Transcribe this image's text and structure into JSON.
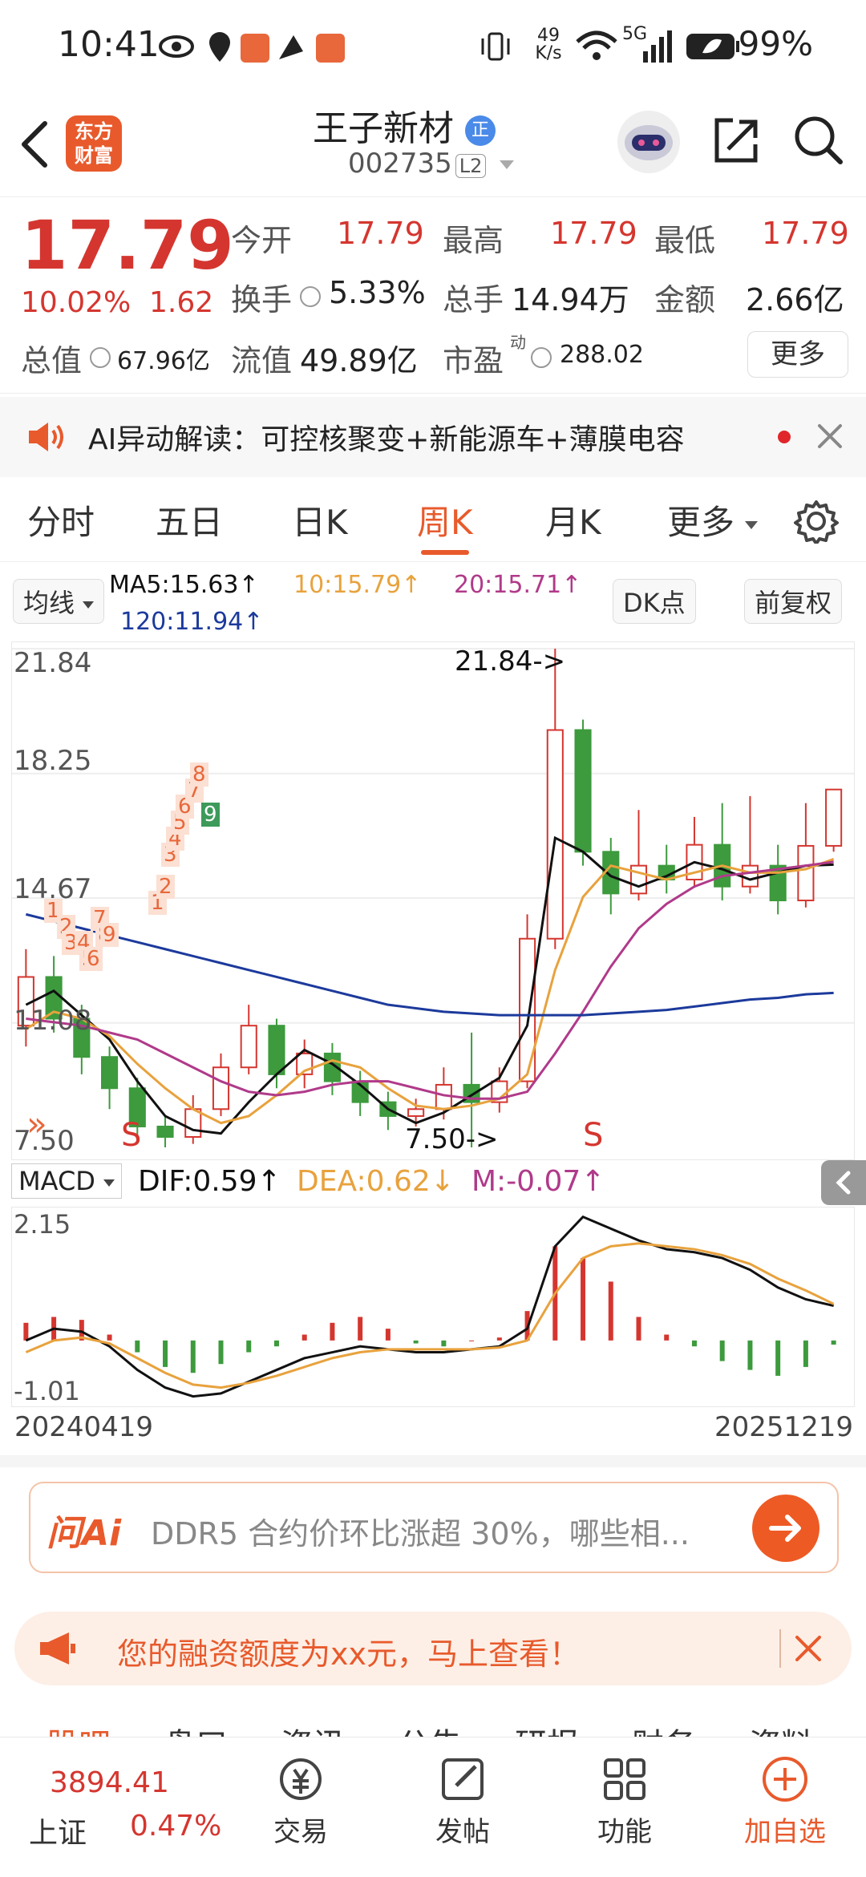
{
  "status": {
    "time": "10:41",
    "net_speed_top": "49",
    "net_speed_bottom": "K/s",
    "network": "5G",
    "battery": "99%"
  },
  "header": {
    "brand_line1": "东方",
    "brand_line2": "财富",
    "stock_name": "王子新材",
    "badge": "正",
    "code": "002735",
    "level_tag": "L2"
  },
  "quote": {
    "price": "17.79",
    "change_pct": "10.02%",
    "change": "1.62",
    "open_label": "今开",
    "open": "17.79",
    "high_label": "最高",
    "high": "17.79",
    "low_label": "最低",
    "low": "17.79",
    "turnover_label": "换手",
    "turnover": "5.33%",
    "volume_label": "总手",
    "volume": "14.94万",
    "amount_label": "金额",
    "amount": "2.66亿",
    "mcap_label": "总值",
    "mcap": "67.96亿",
    "float_label": "流值",
    "float": "49.89亿",
    "pe_label": "市盈",
    "pe_sup": "动",
    "pe": "288.02",
    "more_button": "更多"
  },
  "ai_banner": {
    "text": "AI异动解读：可控核聚变+新能源车+薄膜电容"
  },
  "tabs": [
    {
      "label": "分时"
    },
    {
      "label": "五日"
    },
    {
      "label": "日K"
    },
    {
      "label": "周K"
    },
    {
      "label": "月K"
    },
    {
      "label": "更多"
    }
  ],
  "active_tab": "周K",
  "ma_bar": {
    "selector": "均线",
    "ma5": "MA5:15.63↑",
    "ma10": "10:15.79↑",
    "ma20": "20:15.71↑",
    "ma120": "120:11.94↑",
    "dk_button": "DK点",
    "fq_button": "前复权"
  },
  "chart_data": {
    "type": "candlestick",
    "period": "weekly",
    "y_labels": [
      "21.84",
      "18.25",
      "14.67",
      "11.08",
      "7.50"
    ],
    "max_marker": "21.84->",
    "min_marker": "7.50->",
    "signal_marks": [
      "S",
      "S"
    ],
    "td_counts": [
      "1",
      "2",
      "3",
      "4",
      "5",
      "6",
      "7",
      "8",
      "9"
    ],
    "ylim": [
      7.5,
      21.84
    ],
    "ma_lines": [
      {
        "name": "MA5",
        "color": "#111111",
        "values": [
          11.6,
          12.0,
          11.3,
          10.6,
          9.4,
          8.4,
          8.0,
          7.9,
          8.8,
          9.6,
          10.3,
          9.9,
          9.3,
          8.6,
          8.2,
          8.5,
          9.0,
          9.5,
          11.0,
          16.4,
          16.0,
          15.3,
          15.0,
          15.3,
          15.7,
          15.5,
          15.2,
          15.4,
          15.6,
          15.63
        ]
      },
      {
        "name": "MA10",
        "color": "#e8a23d",
        "values": [
          10.9,
          11.4,
          11.2,
          10.7,
          9.9,
          9.2,
          8.6,
          8.2,
          8.4,
          9.0,
          9.7,
          10.0,
          9.8,
          9.2,
          8.7,
          8.6,
          8.7,
          8.9,
          9.6,
          12.6,
          14.7,
          15.6,
          15.4,
          15.2,
          15.4,
          15.6,
          15.4,
          15.4,
          15.5,
          15.79
        ]
      },
      {
        "name": "MA20",
        "color": "#b03a8a",
        "values": [
          11.2,
          11.1,
          11.0,
          10.8,
          10.6,
          10.2,
          9.8,
          9.4,
          9.1,
          9.0,
          9.1,
          9.3,
          9.4,
          9.4,
          9.2,
          9.0,
          8.9,
          8.9,
          9.1,
          10.2,
          11.4,
          12.7,
          13.8,
          14.5,
          15.0,
          15.3,
          15.4,
          15.5,
          15.6,
          15.71
        ]
      },
      {
        "name": "MA120",
        "color": "#1c3a9c",
        "values": [
          14.2,
          14.0,
          13.8,
          13.6,
          13.4,
          13.2,
          13.0,
          12.8,
          12.6,
          12.4,
          12.2,
          12.0,
          11.8,
          11.6,
          11.5,
          11.4,
          11.35,
          11.3,
          11.3,
          11.3,
          11.3,
          11.35,
          11.4,
          11.45,
          11.55,
          11.65,
          11.75,
          11.8,
          11.9,
          11.94
        ]
      }
    ],
    "candles": [
      {
        "o": 11.0,
        "c": 12.4,
        "h": 13.2,
        "l": 10.4
      },
      {
        "o": 12.4,
        "c": 11.2,
        "h": 13.0,
        "l": 10.8
      },
      {
        "o": 11.2,
        "c": 10.1,
        "h": 11.6,
        "l": 9.6
      },
      {
        "o": 10.1,
        "c": 9.2,
        "h": 10.4,
        "l": 8.6
      },
      {
        "o": 9.2,
        "c": 8.1,
        "h": 9.5,
        "l": 7.8
      },
      {
        "o": 8.1,
        "c": 7.8,
        "h": 8.4,
        "l": 7.5
      },
      {
        "o": 7.8,
        "c": 8.6,
        "h": 9.0,
        "l": 7.6
      },
      {
        "o": 8.6,
        "c": 9.8,
        "h": 10.2,
        "l": 8.4
      },
      {
        "o": 9.8,
        "c": 11.0,
        "h": 11.6,
        "l": 9.6
      },
      {
        "o": 11.0,
        "c": 9.6,
        "h": 11.2,
        "l": 9.2
      },
      {
        "o": 9.6,
        "c": 10.2,
        "h": 10.6,
        "l": 9.2
      },
      {
        "o": 10.2,
        "c": 9.4,
        "h": 10.5,
        "l": 9.0
      },
      {
        "o": 9.4,
        "c": 8.8,
        "h": 9.7,
        "l": 8.4
      },
      {
        "o": 8.8,
        "c": 8.4,
        "h": 9.1,
        "l": 8.0
      },
      {
        "o": 8.4,
        "c": 8.6,
        "h": 8.9,
        "l": 8.1
      },
      {
        "o": 8.6,
        "c": 9.3,
        "h": 9.8,
        "l": 8.3
      },
      {
        "o": 9.3,
        "c": 8.8,
        "h": 10.8,
        "l": 7.5
      },
      {
        "o": 8.8,
        "c": 9.4,
        "h": 9.8,
        "l": 8.5
      },
      {
        "o": 9.4,
        "c": 13.5,
        "h": 14.2,
        "l": 9.2
      },
      {
        "o": 13.5,
        "c": 19.5,
        "h": 21.84,
        "l": 13.2
      },
      {
        "o": 19.5,
        "c": 16.0,
        "h": 19.8,
        "l": 15.6
      },
      {
        "o": 16.0,
        "c": 14.8,
        "h": 16.4,
        "l": 14.2
      },
      {
        "o": 14.8,
        "c": 15.6,
        "h": 17.2,
        "l": 14.6
      },
      {
        "o": 15.6,
        "c": 15.2,
        "h": 16.2,
        "l": 14.8
      },
      {
        "o": 15.2,
        "c": 16.2,
        "h": 17.0,
        "l": 15.0
      },
      {
        "o": 16.2,
        "c": 15.0,
        "h": 17.4,
        "l": 14.6
      },
      {
        "o": 15.0,
        "c": 15.6,
        "h": 17.6,
        "l": 14.8
      },
      {
        "o": 15.6,
        "c": 14.6,
        "h": 16.2,
        "l": 14.2
      },
      {
        "o": 14.6,
        "c": 16.17,
        "h": 17.4,
        "l": 14.4
      },
      {
        "o": 16.17,
        "c": 17.79,
        "h": 17.79,
        "l": 16.0
      }
    ]
  },
  "macd": {
    "selector": "MACD",
    "dif": "DIF:0.59↑",
    "dea": "DEA:0.62↓",
    "m": "M:-0.07↑",
    "y_top": "2.15",
    "y_bottom": "-1.01",
    "chart_data": {
      "type": "bar+line",
      "ylim": [
        -1.01,
        2.15
      ],
      "histogram": [
        0.3,
        0.4,
        0.35,
        0.1,
        -0.2,
        -0.45,
        -0.55,
        -0.4,
        -0.2,
        -0.1,
        0.1,
        0.3,
        0.4,
        0.2,
        -0.05,
        -0.1,
        0.0,
        0.05,
        0.5,
        1.6,
        1.4,
        1.0,
        0.4,
        0.1,
        -0.1,
        -0.35,
        -0.5,
        -0.6,
        -0.45,
        -0.07
      ],
      "dif": [
        0.0,
        0.2,
        0.15,
        -0.1,
        -0.5,
        -0.8,
        -0.95,
        -0.9,
        -0.7,
        -0.5,
        -0.3,
        -0.2,
        -0.1,
        -0.15,
        -0.2,
        -0.2,
        -0.15,
        -0.1,
        0.2,
        1.6,
        2.1,
        1.9,
        1.7,
        1.55,
        1.5,
        1.4,
        1.2,
        0.9,
        0.7,
        0.59
      ],
      "dea": [
        -0.2,
        0.0,
        0.05,
        -0.05,
        -0.3,
        -0.55,
        -0.75,
        -0.8,
        -0.72,
        -0.6,
        -0.45,
        -0.3,
        -0.2,
        -0.15,
        -0.15,
        -0.15,
        -0.15,
        -0.12,
        0.0,
        0.8,
        1.4,
        1.6,
        1.65,
        1.6,
        1.55,
        1.45,
        1.3,
        1.05,
        0.85,
        0.62
      ]
    }
  },
  "dates": {
    "start": "20240419",
    "end": "20251219"
  },
  "ask_ai": {
    "logo": "问Ai",
    "placeholder": "DDR5 合约价环比涨超 30%，哪些相..."
  },
  "promo": {
    "text": "您的融资额度为xx元，马上查看！"
  },
  "sub_tabs": [
    "股吧",
    "盘口",
    "资讯",
    "公告",
    "研报",
    "财务",
    "资料"
  ],
  "bottom": {
    "index_value": "3894.41",
    "index_name": "上证",
    "index_change": "0.47%",
    "trade": "交易",
    "post": "发帖",
    "function": "功能",
    "add": "加自选"
  },
  "colors": {
    "accent": "#e85a2c",
    "up": "#d4362f",
    "down": "#3d9a3d"
  }
}
